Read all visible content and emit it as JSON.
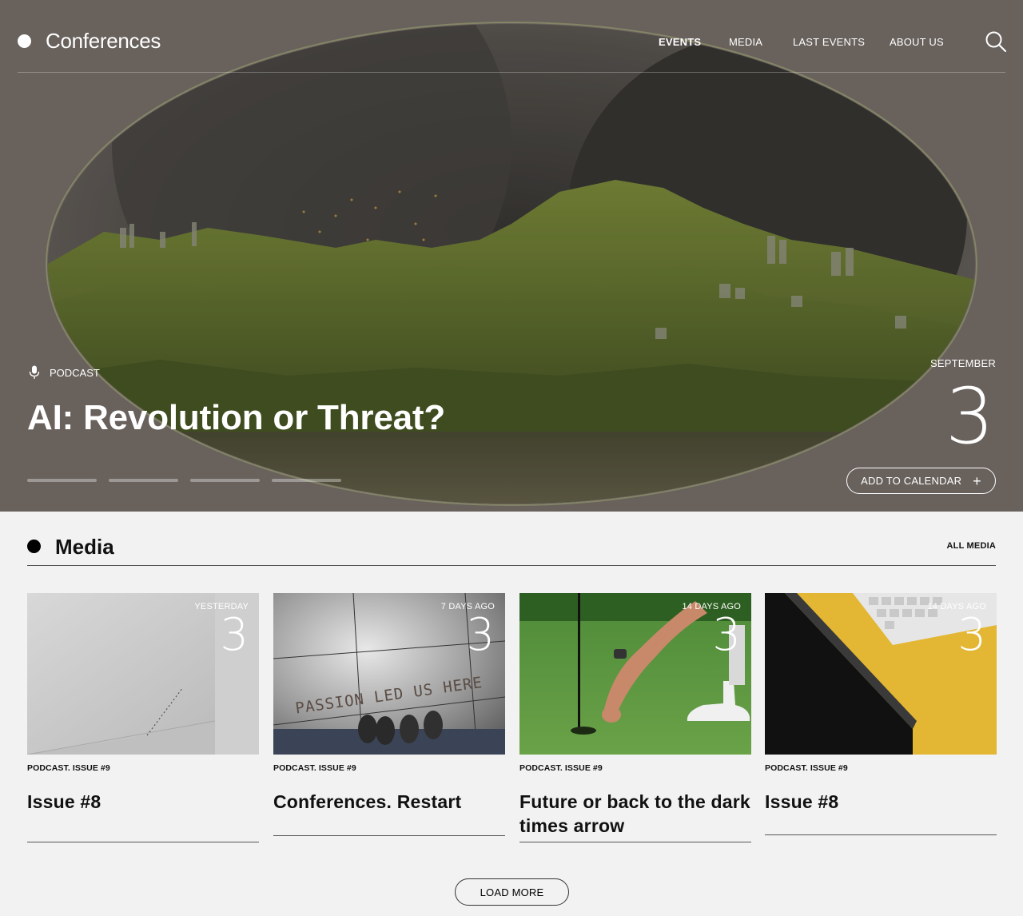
{
  "header": {
    "logo_text": "Conferences",
    "nav": [
      {
        "label": "EVENTS",
        "active": true
      },
      {
        "label": "MEDIA",
        "active": false
      },
      {
        "label": "LAST EVENTS",
        "active": false
      },
      {
        "label": "ABOUT US",
        "active": false
      }
    ],
    "search_icon": "search-icon"
  },
  "hero": {
    "tag_icon": "microphone-icon",
    "tag": "PODCAST",
    "title": "AI: Revolution or Threat?",
    "month": "SEPTEMBER",
    "day": "3",
    "calendar_button": "ADD TO CALENDAR",
    "calendar_icon": "plus-icon",
    "slide_count": 4
  },
  "media": {
    "title": "Media",
    "all_link": "ALL MEDIA",
    "cards": [
      {
        "ago": "YESTERDAY",
        "number": "3",
        "meta": "PODCAST. ISSUE #9",
        "title": "Issue #8"
      },
      {
        "ago": "7 DAYS AGO",
        "number": "3",
        "meta": "PODCAST. ISSUE #9",
        "title": "Conferences. Restart",
        "image_text": "PASSION LED US HERE"
      },
      {
        "ago": "14 DAYS AGO",
        "number": "3",
        "meta": "PODCAST. ISSUE #9",
        "title": "Future or back to the dark times arrow"
      },
      {
        "ago": "14 DAYS AGO",
        "number": "3",
        "meta": "PODCAST. ISSUE #9",
        "title": "Issue #8"
      }
    ],
    "load_more": "LOAD MORE"
  }
}
